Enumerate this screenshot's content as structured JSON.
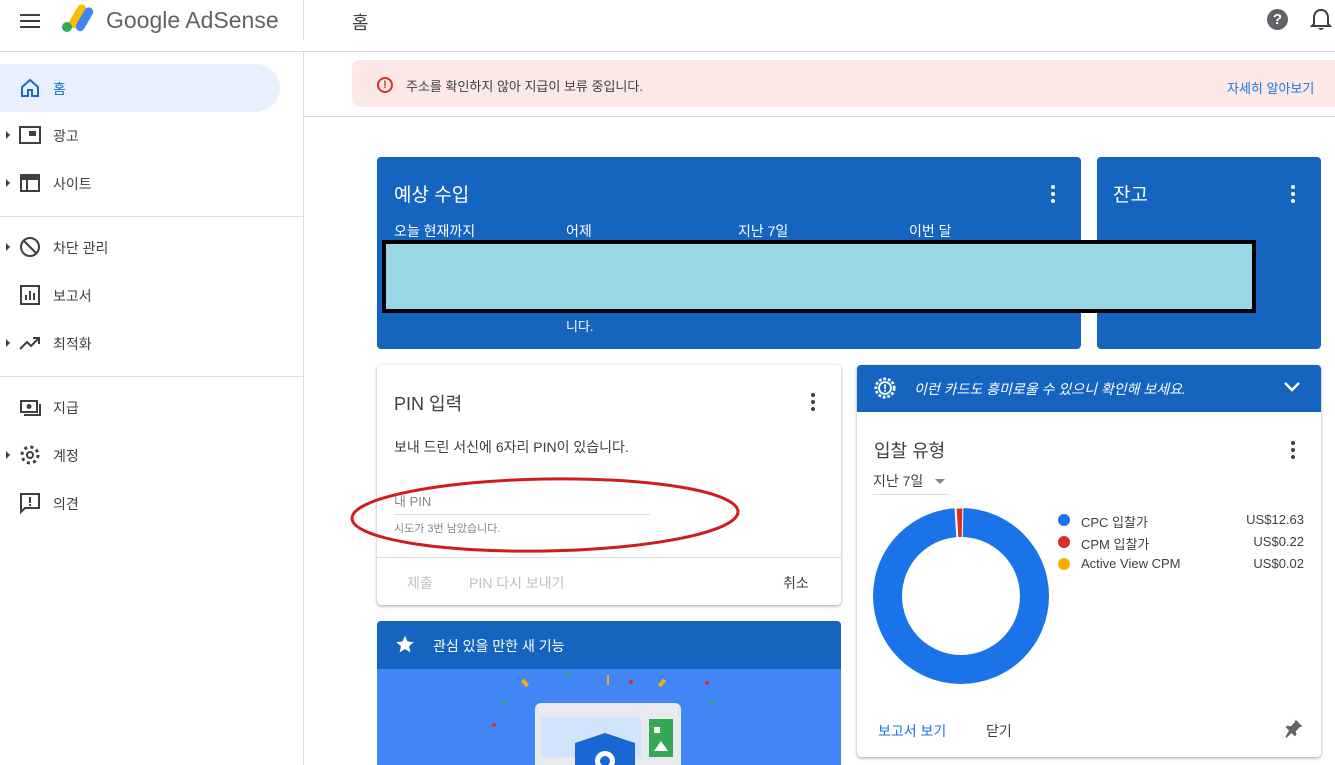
{
  "app": {
    "name": "Google AdSense",
    "page_title": "홈"
  },
  "sidebar": {
    "items": [
      {
        "label": "홈",
        "icon": "home-icon",
        "active": true
      },
      {
        "label": "광고",
        "icon": "ads-icon"
      },
      {
        "label": "사이트",
        "icon": "sites-icon"
      },
      {
        "label": "차단 관리",
        "icon": "block-icon"
      },
      {
        "label": "보고서",
        "icon": "reports-icon"
      },
      {
        "label": "최적화",
        "icon": "trending-up-icon"
      },
      {
        "label": "지급",
        "icon": "payments-icon"
      },
      {
        "label": "계정",
        "icon": "gear-icon"
      },
      {
        "label": "의견",
        "icon": "feedback-icon"
      }
    ]
  },
  "alert": {
    "text": "주소를 확인하지 않아 지급이 보류 중입니다.",
    "link": "자세히 알아보기"
  },
  "earnings": {
    "title": "예상 수입",
    "columns": [
      "오늘 현재까지",
      "어제",
      "지난 7일",
      "이번 달"
    ],
    "fragment": "니다."
  },
  "balance": {
    "title": "잔고"
  },
  "pin": {
    "title": "PIN 입력",
    "description": "보내 드린 서신에 6자리 PIN이 있습니다.",
    "input_placeholder": "내 PIN",
    "helper": "시도가 3번 남았습니다.",
    "submit": "제출",
    "resend": "PIN 다시 보내기",
    "cancel": "취소"
  },
  "features": {
    "title": "관심 있을 만한 새 기능"
  },
  "bid": {
    "banner": "이런 카드도 흥미로울 수 있으니 확인해 보세요.",
    "title": "입찰 유형",
    "range": "지난 7일",
    "view_report": "보고서 보기",
    "close": "닫기",
    "legend": [
      {
        "label": "CPC 입찰가",
        "value": "US$12.63",
        "color": "#1a73e8"
      },
      {
        "label": "CPM 입찰가",
        "value": "US$0.22",
        "color": "#d93025"
      },
      {
        "label": "Active View CPM",
        "value": "US$0.02",
        "color": "#f9ab00"
      }
    ]
  },
  "colors": {
    "card_blue": "#1565c0",
    "redaction": "#9ad8e6",
    "annotation_red": "#d01c1c"
  }
}
